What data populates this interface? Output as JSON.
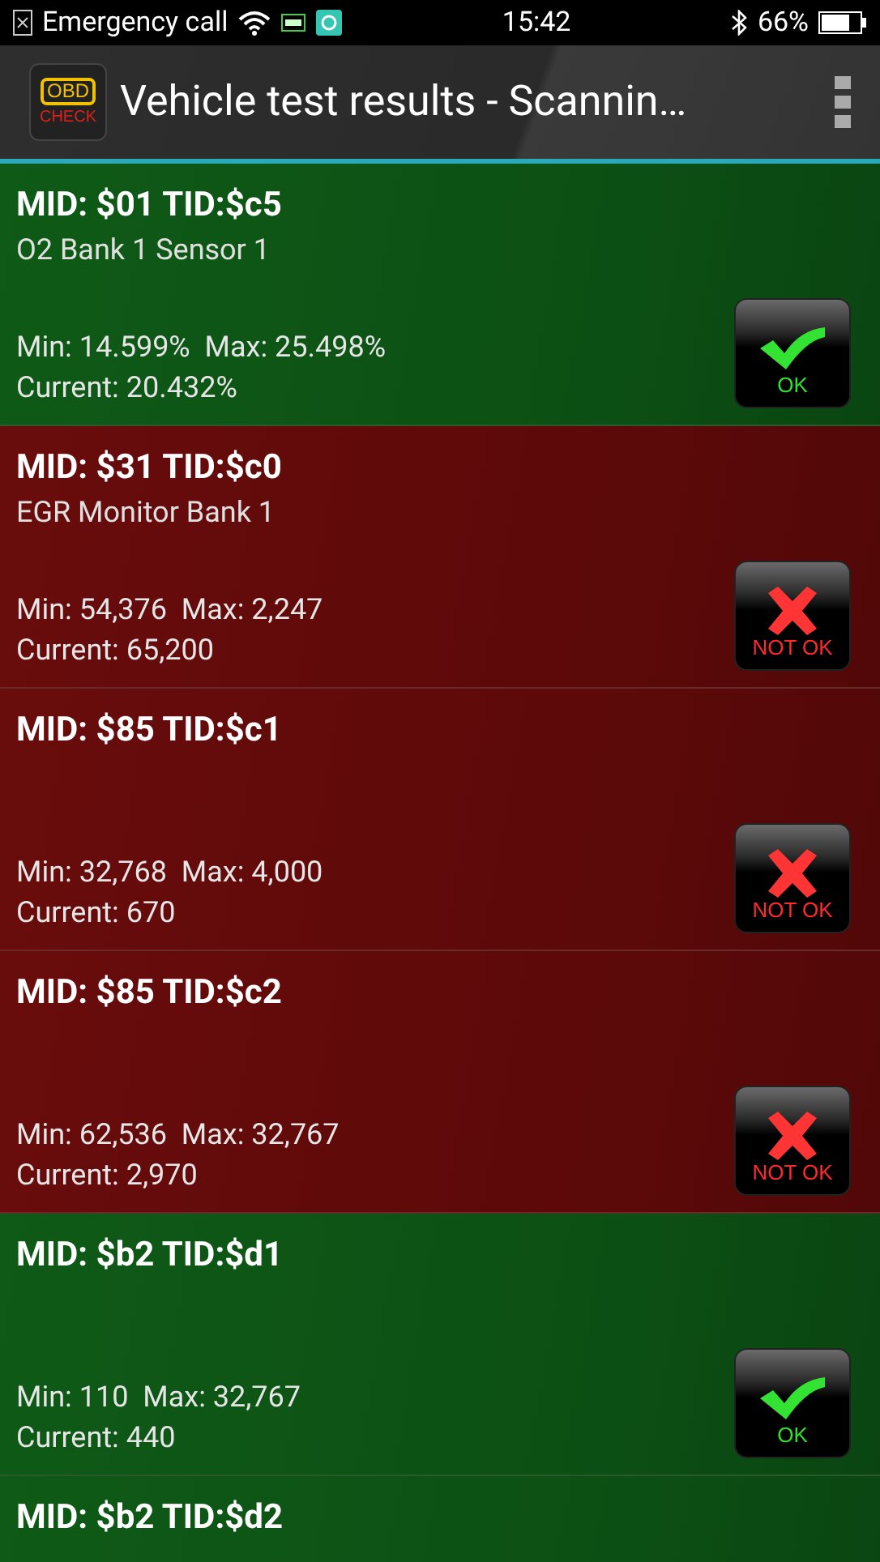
{
  "status_bar": {
    "carrier": "Emergency call",
    "time": "15:42",
    "battery": "66%"
  },
  "app_bar": {
    "logo": {
      "top": "OBD",
      "bottom": "CHECK"
    },
    "title": "Vehicle test results - Scannin…"
  },
  "results": [
    {
      "title": "MID: $01 TID:$c5",
      "subtitle": "O2 Bank 1 Sensor 1",
      "range": "Min: 14.599%  Max: 25.498%",
      "current": "Current: 20.432%",
      "passed": true,
      "badge": "OK"
    },
    {
      "title": "MID: $31 TID:$c0",
      "subtitle": "EGR Monitor Bank 1",
      "range": "Min: 54,376  Max: 2,247",
      "current": "Current: 65,200",
      "passed": false,
      "badge": "NOT OK"
    },
    {
      "title": "MID: $85 TID:$c1",
      "range": "Min: 32,768  Max: 4,000",
      "current": "Current: 670",
      "passed": false,
      "badge": "NOT OK"
    },
    {
      "title": "MID: $85 TID:$c2",
      "range": "Min: 62,536  Max: 32,767",
      "current": "Current: 2,970",
      "passed": false,
      "badge": "NOT OK"
    },
    {
      "title": "MID: $b2 TID:$d1",
      "range": "Min: 110  Max: 32,767",
      "current": "Current: 440",
      "passed": true,
      "badge": "OK"
    },
    {
      "title": "MID: $b2 TID:$d2",
      "passed": true
    }
  ]
}
